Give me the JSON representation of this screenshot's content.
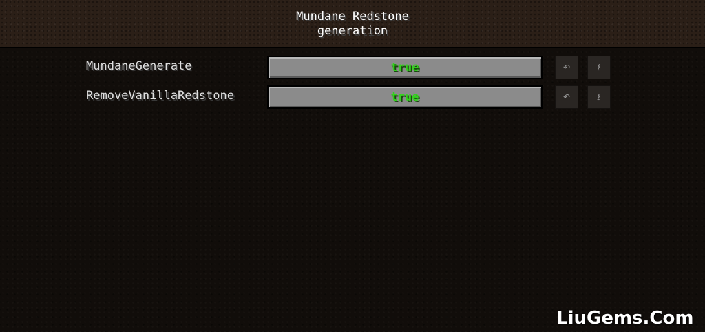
{
  "screen": {
    "title": "Mundane Redstone\ngeneration"
  },
  "options": [
    {
      "label": "MundaneGenerate",
      "value": "true",
      "undo_icon": "↶",
      "reset_icon": "ℓ"
    },
    {
      "label": "RemoveVanillaRedstone",
      "value": "true",
      "undo_icon": "↶",
      "reset_icon": "ℓ"
    }
  ],
  "colors": {
    "value_true": "#33d11c",
    "button_face": "#8b8b8b"
  },
  "icons": {
    "undo": "undo-icon",
    "reset": "reset-to-default-icon"
  },
  "watermark": {
    "text": "LiuGems.Com"
  }
}
